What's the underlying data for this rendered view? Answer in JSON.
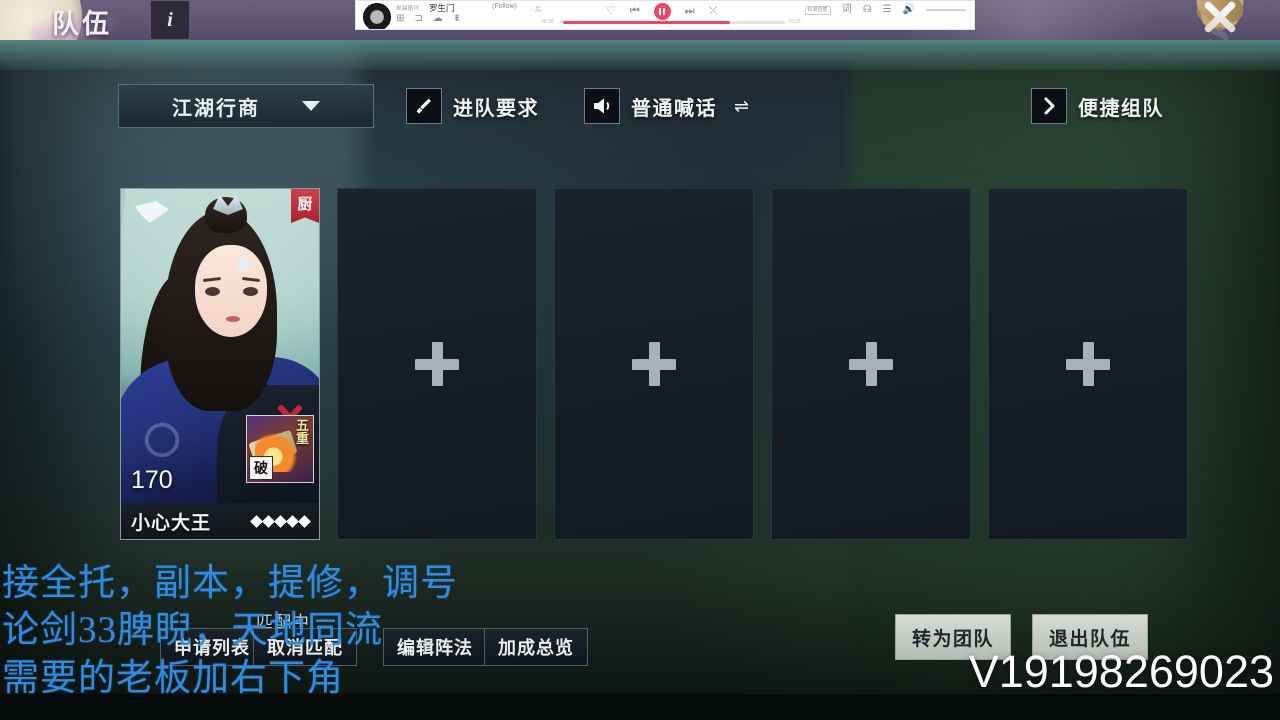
{
  "header": {
    "title": "队伍",
    "info_icon_label": "i",
    "close_icon": "close-icon",
    "ghost_watermark": "S"
  },
  "player": {
    "tag": "单曲循环",
    "song": "罗生门",
    "mode": "(Follow)",
    "artist": "- 后",
    "time_left": "00:56",
    "time_right": "03:23",
    "quality": "标准音质",
    "actions": [
      "download-icon",
      "folder-icon",
      "cloud-icon",
      "save-icon"
    ],
    "controls": [
      "heart-icon",
      "prev-icon",
      "pause-icon",
      "next-icon",
      "shuffle-icon"
    ],
    "right_icons": [
      "lyrics-icon",
      "effects-icon",
      "playlist-icon",
      "volume-icon"
    ]
  },
  "toolbar": {
    "dropdown_label": "江湖行商",
    "dropdown_caret": "chevron-down-icon",
    "join_req_label": "进队要求",
    "join_req_icon": "brush-icon",
    "shout_label": "普通喊话",
    "shout_icon": "speaker-icon",
    "swap_icon": "swap-icon",
    "quick_team_label": "便捷组队",
    "quick_team_icon": "chevron-right-icon"
  },
  "members": [
    {
      "occupied": true,
      "job_badge": "厨",
      "level": "170",
      "name": "小心大王",
      "stars": 5,
      "skill_level": [
        "五",
        "重"
      ],
      "skill_tag": "破",
      "flag_icon": "flag-icon"
    },
    {
      "occupied": false,
      "add_icon": "plus-icon"
    },
    {
      "occupied": false,
      "add_icon": "plus-icon"
    },
    {
      "occupied": false,
      "add_icon": "plus-icon"
    },
    {
      "occupied": false,
      "add_icon": "plus-icon"
    }
  ],
  "bottom": {
    "matching_status": "匹配中...",
    "apply_list_label": "申请列表",
    "cancel_match_label": "取消匹配",
    "edit_formation_label": "编辑阵法",
    "bonus_overview_label": "加成总览",
    "to_raid_label": "转为团队",
    "leave_team_label": "退出队伍"
  },
  "overlay_ad": {
    "line1": "接全托，副本，提修，调号",
    "line2": "论剑33脾睨，天地同流",
    "line3": "需要的老板加右下角",
    "watermark": "V19198269023",
    "color": "#2f8ce0"
  }
}
